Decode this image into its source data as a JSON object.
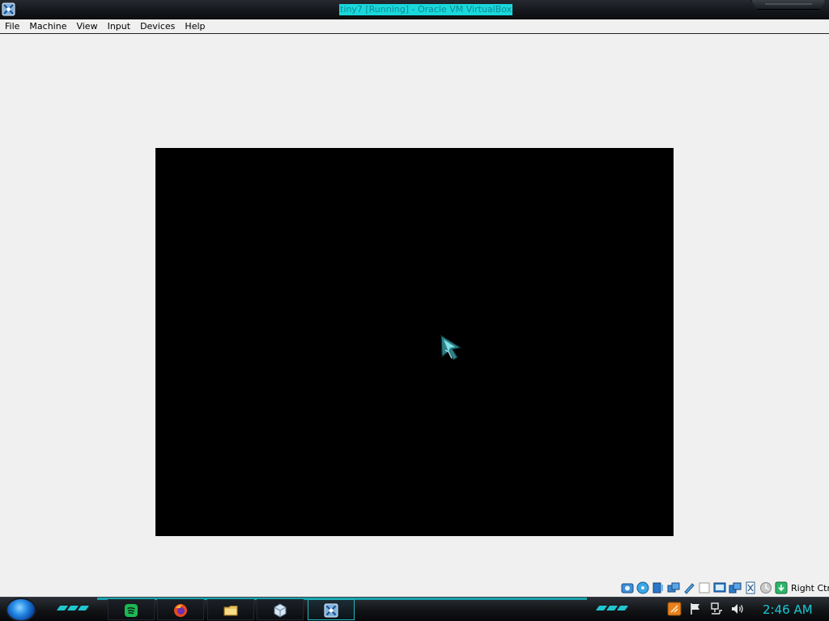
{
  "window": {
    "title": "tiny7 [Running] - Oracle VM VirtualBox"
  },
  "menu": {
    "items": [
      "File",
      "Machine",
      "View",
      "Input",
      "Devices",
      "Help"
    ]
  },
  "statusbar": {
    "icons": [
      "hard-disk-icon",
      "optical-drive-icon",
      "audio-icon",
      "network-icon",
      "usb-icon",
      "shared-folders-icon",
      "display-icon",
      "video-capture-icon",
      "processor-icon",
      "mouse-integration-icon",
      "keyboard-capture-icon"
    ],
    "host_key": "Right Ctrl"
  },
  "taskbar": {
    "apps": [
      "spotify-icon",
      "firefox-icon",
      "file-explorer-icon",
      "virtualbox-manager-icon",
      "virtualbox-vm-icon"
    ],
    "tray_icons": [
      "update-icon",
      "action-center-flag-icon",
      "network-icon",
      "volume-icon"
    ],
    "clock": "2:46 AM"
  },
  "colors": {
    "accent": "#19d8dc",
    "titlebar": "#15181c",
    "vm_screen": "#000000",
    "window_bg": "#f0f0f0"
  }
}
